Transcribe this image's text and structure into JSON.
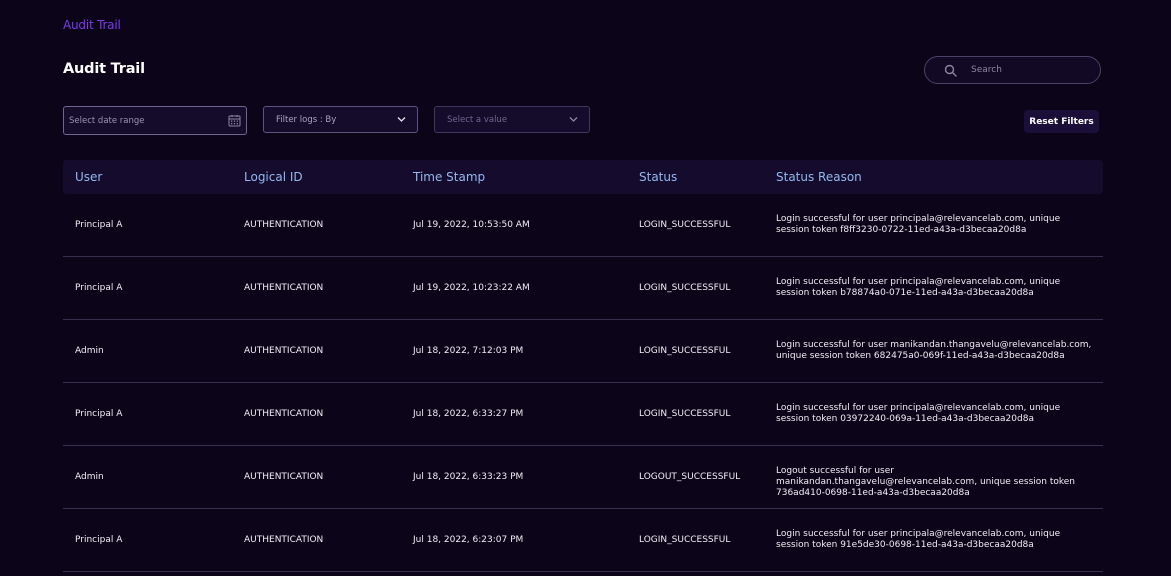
{
  "breadcrumb": "Audit Trail",
  "page_title": "Audit Trail",
  "search": {
    "placeholder": "Search",
    "value": ""
  },
  "filters": {
    "date_range_placeholder": "Select date range",
    "filter_by_label": "Filter logs : By",
    "value_placeholder": "Select a value",
    "reset_label": "Reset Filters"
  },
  "icons": {
    "search": "search-icon",
    "calendar": "calendar-icon",
    "chevron": "chevron-down-icon"
  },
  "colors": {
    "background": "#0c0519",
    "accent": "#7c3aed",
    "header_text": "#93b8ef",
    "button_bg": "#1b0f3a"
  },
  "table": {
    "headers": [
      "User",
      "Logical ID",
      "Time Stamp",
      "Status",
      "Status Reason"
    ],
    "rows": [
      [
        "Principal A",
        "AUTHENTICATION",
        "Jul 19, 2022, 10:53:50 AM",
        "LOGIN_SUCCESSFUL",
        "Login successful for user principala@relevancelab.com, unique session token f8ff3230-0722-11ed-a43a-d3becaa20d8a"
      ],
      [
        "Principal A",
        "AUTHENTICATION",
        "Jul 19, 2022, 10:23:22 AM",
        "LOGIN_SUCCESSFUL",
        "Login successful for user principala@relevancelab.com, unique session token b78874a0-071e-11ed-a43a-d3becaa20d8a"
      ],
      [
        "Admin",
        "AUTHENTICATION",
        "Jul 18, 2022, 7:12:03 PM",
        "LOGIN_SUCCESSFUL",
        "Login successful for user manikandan.thangavelu@relevancelab.com, unique session token 682475a0-069f-11ed-a43a-d3becaa20d8a"
      ],
      [
        "Principal A",
        "AUTHENTICATION",
        "Jul 18, 2022, 6:33:27 PM",
        "LOGIN_SUCCESSFUL",
        "Login successful for user principala@relevancelab.com, unique session token 03972240-069a-11ed-a43a-d3becaa20d8a"
      ],
      [
        "Admin",
        "AUTHENTICATION",
        "Jul 18, 2022, 6:33:23 PM",
        "LOGOUT_SUCCESSFUL",
        "Logout successful for user manikandan.thangavelu@relevancelab.com, unique session token 736ad410-0698-11ed-a43a-d3becaa20d8a"
      ],
      [
        "Principal A",
        "AUTHENTICATION",
        "Jul 18, 2022, 6:23:07 PM",
        "LOGIN_SUCCESSFUL",
        "Login successful for user principala@relevancelab.com, unique session token 91e5de30-0698-11ed-a43a-d3becaa20d8a"
      ]
    ]
  }
}
